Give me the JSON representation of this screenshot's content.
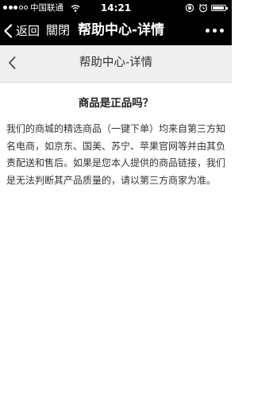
{
  "status_bar": {
    "carrier": "中国联通",
    "time": "14:21",
    "battery_level": 0.9
  },
  "wechat_nav": {
    "back_label": "返回",
    "close_label": "關閉",
    "title": "帮助中心-详情"
  },
  "page_header": {
    "title": "帮助中心-详情"
  },
  "article": {
    "question": "商品是正品吗？",
    "answer": "我们的商城的精选商品（一键下单）均来自第三方知名电商，如京东、国美、苏宁、苹果官网等并由其负责配送和售后。如果是您本人提供的商品链接，我们是无法判断其产品质量的，请以第三方商家为准。"
  },
  "colors": {
    "nav_background": "#000000",
    "header_background": "#efefef",
    "page_background": "#ffffff"
  }
}
